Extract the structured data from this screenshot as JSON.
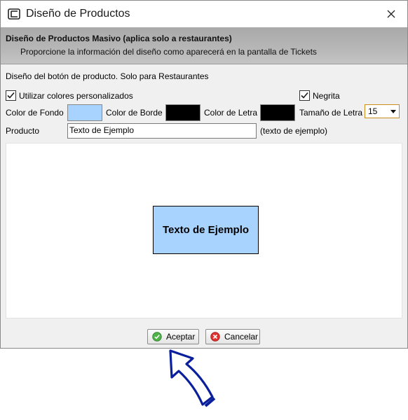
{
  "window": {
    "title": "Diseño de Productos"
  },
  "header": {
    "title": "Diseño de Productos Masivo (aplica solo a restaurantes)",
    "subtitle": "Proporcione la información del diseño como aparecerá en la pantalla de Tickets"
  },
  "section": {
    "title": "Diseño del botón de producto. Solo para Restaurantes"
  },
  "options": {
    "custom_colors_label": "Utilizar colores personalizados",
    "custom_colors_checked": true,
    "bold_label": "Negrita",
    "bold_checked": true
  },
  "colors": {
    "background_label": "Color de Fondo",
    "background_value": "#a8d3ff",
    "border_label": "Color de Borde",
    "border_value": "#000000",
    "text_label": "Color de Letra",
    "text_value": "#000000",
    "font_size_label": "Tamaño de Letra",
    "font_size_value": "15"
  },
  "product": {
    "label": "Producto",
    "value": "Texto de Ejemplo",
    "hint": "(texto de ejemplo)"
  },
  "preview": {
    "text": "Texto de Ejemplo"
  },
  "buttons": {
    "accept_label": "Aceptar",
    "cancel_label": "Cancelar"
  }
}
